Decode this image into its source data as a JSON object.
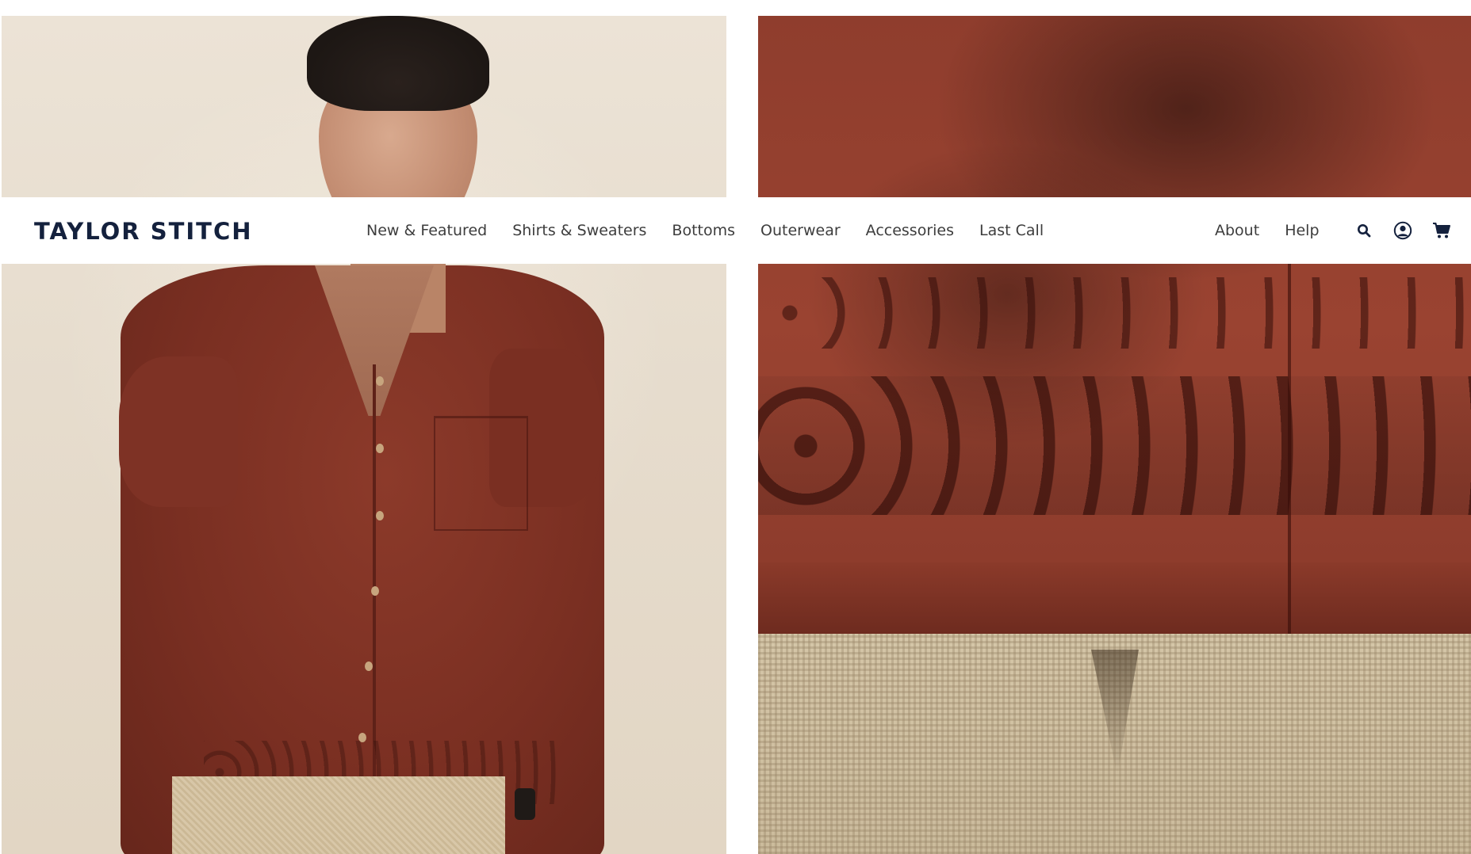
{
  "brand": {
    "logo_text": "TAYLOR STITCH",
    "primary_color": "#14213d"
  },
  "nav": {
    "main_links": [
      {
        "label": "New & Featured"
      },
      {
        "label": "Shirts & Sweaters"
      },
      {
        "label": "Bottoms"
      },
      {
        "label": "Outerwear"
      },
      {
        "label": "Accessories"
      },
      {
        "label": "Last Call"
      }
    ],
    "secondary_links": [
      {
        "label": "About"
      },
      {
        "label": "Help"
      }
    ],
    "icons": {
      "search": "search-icon",
      "account": "account-icon",
      "cart": "cart-icon"
    },
    "text_color": "#3d3d3d"
  },
  "hero": {
    "left_image": "model-wearing-rust-short-sleeve-camp-shirt",
    "right_image": "close-up-eyelet-embroidery-shirt-hem",
    "shirt_color": "#7a2f22",
    "background_color": "#e6dccd"
  }
}
